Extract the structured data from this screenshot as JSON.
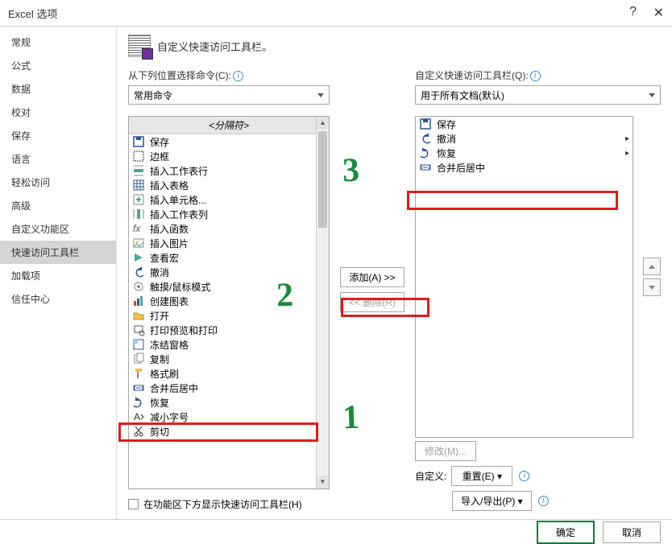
{
  "window": {
    "title": "Excel 选项",
    "help": "?",
    "close": "✕"
  },
  "sidebar": {
    "items": [
      {
        "label": "常规"
      },
      {
        "label": "公式"
      },
      {
        "label": "数据"
      },
      {
        "label": "校对"
      },
      {
        "label": "保存"
      },
      {
        "label": "语言"
      },
      {
        "label": "轻松访问"
      },
      {
        "label": "高级"
      },
      {
        "label": "自定义功能区"
      },
      {
        "label": "快速访问工具栏"
      },
      {
        "label": "加载项"
      },
      {
        "label": "信任中心"
      }
    ],
    "selected_index": 9
  },
  "header": "自定义快速访问工具栏。",
  "left": {
    "label": "从下列位置选择命令(C):",
    "combo": "常用命令",
    "list_header": "<分隔符>",
    "items": [
      {
        "icon": "save",
        "label": "保存"
      },
      {
        "icon": "border",
        "label": "边框",
        "submenu": true
      },
      {
        "icon": "insert-row",
        "label": "插入工作表行"
      },
      {
        "icon": "insert-table",
        "label": "插入表格"
      },
      {
        "icon": "insert-cells",
        "label": "插入单元格..."
      },
      {
        "icon": "insert-col",
        "label": "插入工作表列"
      },
      {
        "icon": "fx",
        "label": "插入函数"
      },
      {
        "icon": "picture",
        "label": "插入图片"
      },
      {
        "icon": "macro",
        "label": "查看宏"
      },
      {
        "icon": "undo",
        "label": "撤消",
        "submenu": true
      },
      {
        "icon": "touch",
        "label": "触摸/鼠标模式"
      },
      {
        "icon": "chart",
        "label": "创建图表"
      },
      {
        "icon": "open",
        "label": "打开"
      },
      {
        "icon": "print-preview",
        "label": "打印预览和打印"
      },
      {
        "icon": "freeze",
        "label": "冻结窗格",
        "submenu": true
      },
      {
        "icon": "copy",
        "label": "复制"
      },
      {
        "icon": "format-painter",
        "label": "格式刷"
      },
      {
        "icon": "merge-center",
        "label": "合并后居中"
      },
      {
        "icon": "redo",
        "label": "恢复",
        "submenu": true
      },
      {
        "icon": "font-decrease",
        "label": "减小字号"
      },
      {
        "icon": "cut",
        "label": "剪切"
      }
    ]
  },
  "mid": {
    "add": "添加(A) >>",
    "remove": "<< 删除(R)"
  },
  "right": {
    "label": "自定义快速访问工具栏(Q):",
    "combo": "用于所有文档(默认)",
    "items": [
      {
        "icon": "save",
        "label": "保存"
      },
      {
        "icon": "undo",
        "label": "撤消",
        "submenu": true
      },
      {
        "icon": "redo",
        "label": "恢复",
        "submenu": true
      },
      {
        "icon": "merge-center",
        "label": "合并后居中"
      }
    ],
    "modify": "修改(M)...",
    "custom_label": "自定义:",
    "reset": "重置(E) ▾",
    "import_export": "导入/导出(P) ▾"
  },
  "checkbox": "在功能区下方显示快速访问工具栏(H)",
  "footer": {
    "ok": "确定",
    "cancel": "取消"
  },
  "annotations": {
    "g1": "1",
    "g2": "2",
    "g3": "3"
  }
}
